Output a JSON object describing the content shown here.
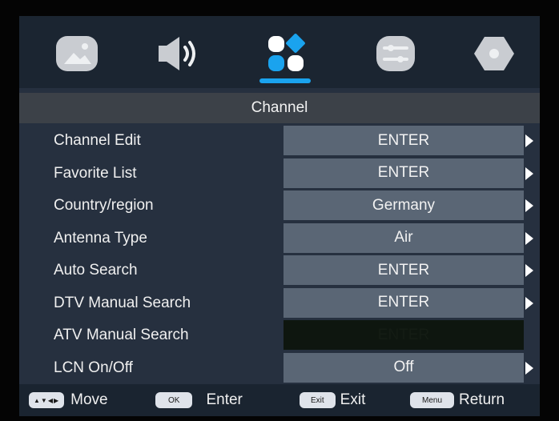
{
  "tabs": [
    {
      "name": "picture",
      "icon": "picture-icon"
    },
    {
      "name": "sound",
      "icon": "speaker-icon"
    },
    {
      "name": "channel",
      "icon": "apps-grid-icon",
      "active": true
    },
    {
      "name": "settings",
      "icon": "sliders-icon"
    },
    {
      "name": "lock",
      "icon": "hexagon-icon"
    }
  ],
  "title": "Channel",
  "menu": {
    "items": [
      {
        "label": "Channel Edit",
        "value": "ENTER"
      },
      {
        "label": "Favorite List",
        "value": "ENTER"
      },
      {
        "label": "Country/region",
        "value": "Germany"
      },
      {
        "label": "Antenna Type",
        "value": "Air"
      },
      {
        "label": "Auto Search",
        "value": "ENTER"
      },
      {
        "label": "DTV Manual Search",
        "value": "ENTER"
      },
      {
        "label": "ATV Manual Search",
        "value": "ENTER"
      },
      {
        "label": "LCN On/Off",
        "value": "Off"
      }
    ]
  },
  "footer": {
    "move_key": "▲▼◀▶",
    "move_label": "Move",
    "ok_key": "OK",
    "ok_label": "Enter",
    "exit_key": "Exit",
    "exit_label": "Exit",
    "menu_key": "Menu",
    "menu_label": "Return"
  },
  "colors": {
    "accent": "#1aa3ee",
    "value_box": "#5a6675",
    "disabled_box": "#0e160f",
    "title_bar": "#3c4148"
  }
}
